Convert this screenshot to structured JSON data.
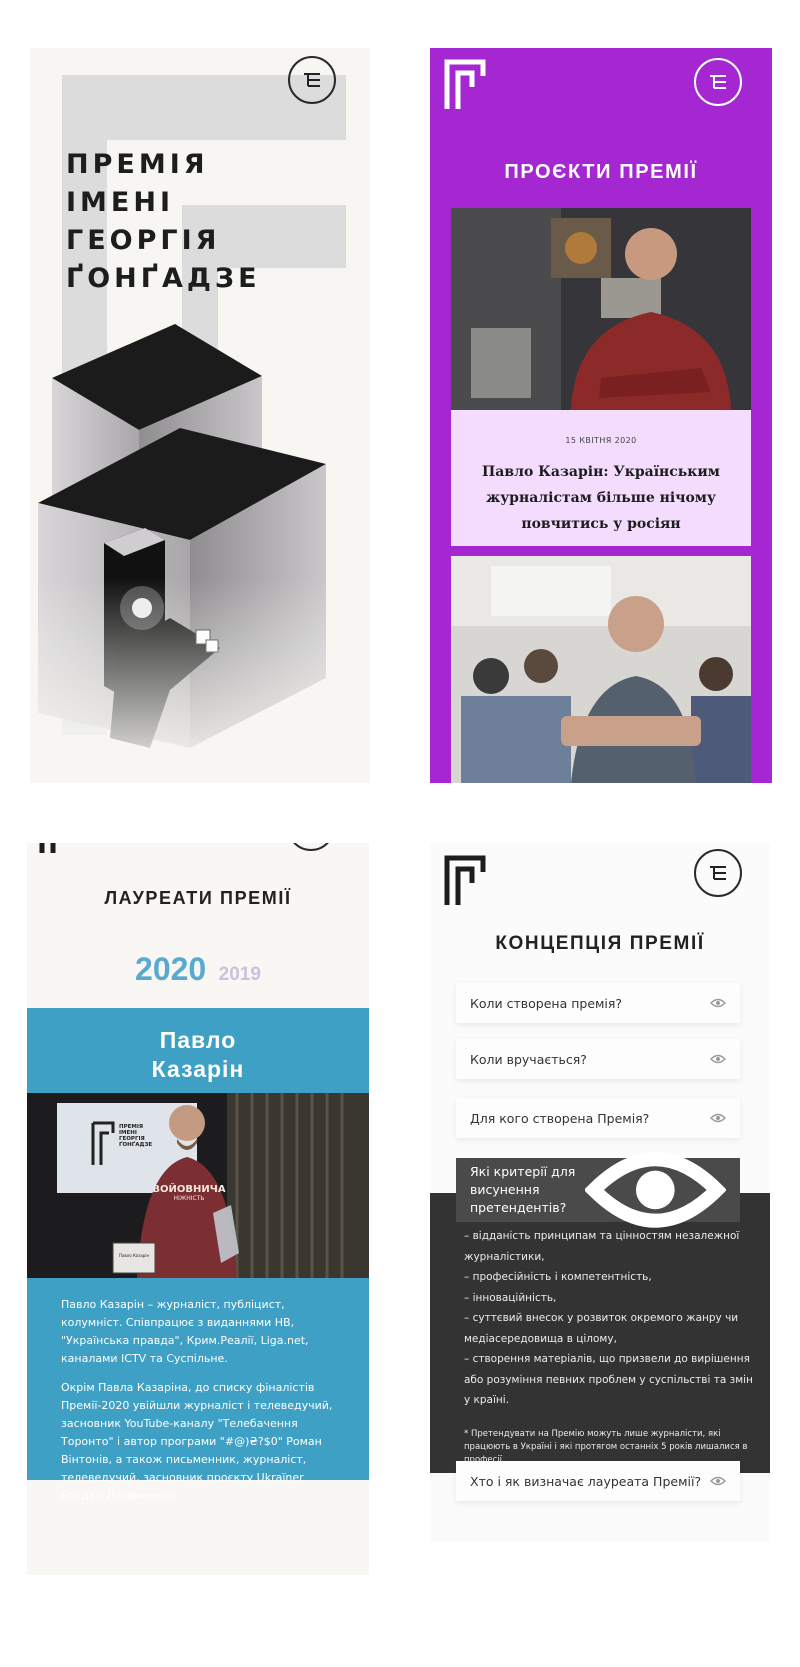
{
  "screen1": {
    "title_lines": [
      "ПРЕМІЯ",
      "ІМЕНІ",
      "ГЕОРГІЯ",
      "ҐОНҐАДЗЕ"
    ],
    "menu_icon": "menu-icon"
  },
  "screen2": {
    "heading": "ПРОЄКТИ ПРЕМІЇ",
    "background_color": "#a427d2",
    "cards": [
      {
        "date": "15 КВІТНЯ 2020",
        "title": "Павло Казарін: Українським журналістам більше нічому повчитись у росіян"
      },
      {
        "date": "",
        "title": ""
      }
    ]
  },
  "screen3": {
    "heading": "ЛАУРЕАТИ ПРЕМІЇ",
    "year_active": "2020",
    "year_other": "2019",
    "laureate_name_line1": "Павло",
    "laureate_name_line2": "Казарін",
    "photo_sign_line1": "ПРЕМІЯ",
    "photo_sign_line2": "ІМЕНІ",
    "photo_sign_line3": "ГЕОРГІЯ",
    "photo_sign_line4": "ҐОНҐАДЗЕ",
    "shirt_text_line1": "ВОЙОВНИЧА",
    "shirt_text_line2": "НІЖНІСТЬ",
    "plaque_text": "Павло Казарін",
    "paragraph1": "Павло Казарін – журналіст, публіцист, колумніст. Співпрацює з виданнями НВ, \"Українська правда\", Крим.Реалії, Liga.net, каналами ICTV та Суспільне.",
    "paragraph2": "Окрім Павла Казаріна, до списку фіналістів Премії-2020 увійшли журналіст і телеведучий, засновник YouTube-каналу \"Телебачення Торонто\" і автор програми \"#@)₴?$0\" Роман Вінтонів, а також письменник, журналіст, телеведучий, засновник проєкту Ukraїner Богдан Логвиненко",
    "accent_color": "#3ea0c5"
  },
  "screen4": {
    "heading": "КОНЦЕПЦІЯ ПРЕМІЇ",
    "faq": [
      {
        "question": "Коли створена премія?"
      },
      {
        "question": "Коли вручається?"
      },
      {
        "question": "Для кого створена Премія?"
      },
      {
        "question": "Які критерії для висунення претендентів?"
      },
      {
        "question": "Хто і як визначає лауреата Премії?"
      }
    ],
    "criteria": [
      "– відданість принципам та цінностям незалежної журналістики,",
      "– професійність і компетентність,",
      "– інноваційність,",
      "– суттєвий внесок у розвиток окремого жанру чи медіасередовища в цілому,",
      "– створення матеріалів, що призвели до вирішення або розуміння певних проблем у суспільстві та змін у країні."
    ],
    "footnote": "* Претендувати на Премію можуть лише журналісти, які працюють в Україні і які протягом останніх 5 років лишалися в професії.",
    "eye_icon": "eye-icon"
  }
}
